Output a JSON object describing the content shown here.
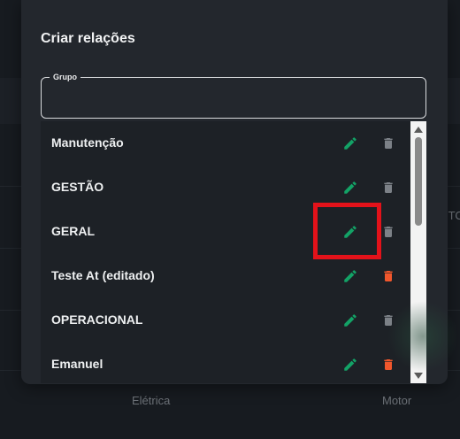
{
  "dialog": {
    "title": "Criar relações",
    "field_label": "Grupo",
    "field_value": ""
  },
  "groups": [
    {
      "name": "Manutenção",
      "delete_enabled": false
    },
    {
      "name": "GESTÃO",
      "delete_enabled": false
    },
    {
      "name": "GERAL",
      "delete_enabled": false
    },
    {
      "name": "Teste At (editado)",
      "delete_enabled": true
    },
    {
      "name": "OPERACIONAL",
      "delete_enabled": false
    },
    {
      "name": "Emanuel",
      "delete_enabled": true
    }
  ],
  "background": {
    "col_a": "Elétrica",
    "col_b": "Motor",
    "partial_header": "ITO"
  },
  "icons": {
    "edit": "pencil-icon",
    "delete": "trash-icon",
    "scroll_up": "triangle-up-icon",
    "scroll_down": "triangle-down-icon"
  },
  "colors": {
    "edit": "#13a266",
    "delete_active": "#f1572c",
    "delete_disabled": "#7c8187",
    "highlight": "#e3121a"
  }
}
